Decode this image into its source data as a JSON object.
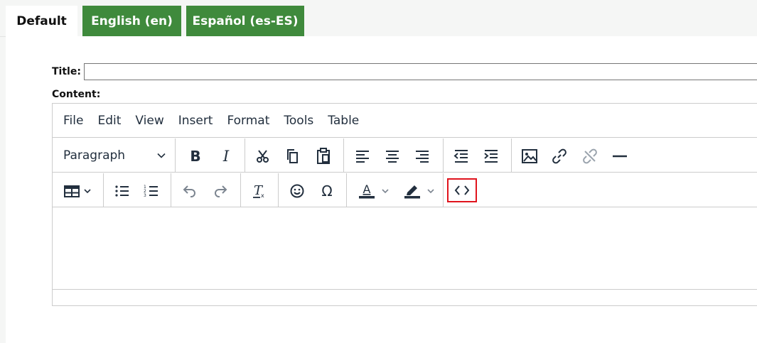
{
  "tabs": [
    {
      "label": "Default"
    },
    {
      "label": "English (en)"
    },
    {
      "label": "Español (es-ES)"
    }
  ],
  "colors": {
    "tab_active_bg": "#ffffff",
    "tab_green": "#3f8a3c",
    "highlight": "#e0141d",
    "editor_border": "#cccccc"
  },
  "form": {
    "title_label": "Title:",
    "title_value": "",
    "content_label": "Content:"
  },
  "editor": {
    "menubar": [
      "File",
      "Edit",
      "View",
      "Insert",
      "Format",
      "Tools",
      "Table"
    ],
    "block_format": "Paragraph",
    "toolbar_row1_icons": [
      "bold-icon",
      "italic-icon",
      "cut-icon",
      "copy-icon",
      "paste-icon",
      "align-left-icon",
      "align-center-icon",
      "align-right-icon",
      "outdent-icon",
      "indent-icon",
      "image-icon",
      "link-icon",
      "unlink-icon",
      "horizontal-rule-icon"
    ],
    "toolbar_row2_icons": [
      "table-icon",
      "bullet-list-icon",
      "numbered-list-icon",
      "undo-icon",
      "redo-icon",
      "clear-format-icon",
      "emoji-icon",
      "special-char-icon",
      "text-color-icon",
      "highlight-color-icon",
      "source-code-icon"
    ],
    "highlighted_button": "source-code-icon"
  }
}
